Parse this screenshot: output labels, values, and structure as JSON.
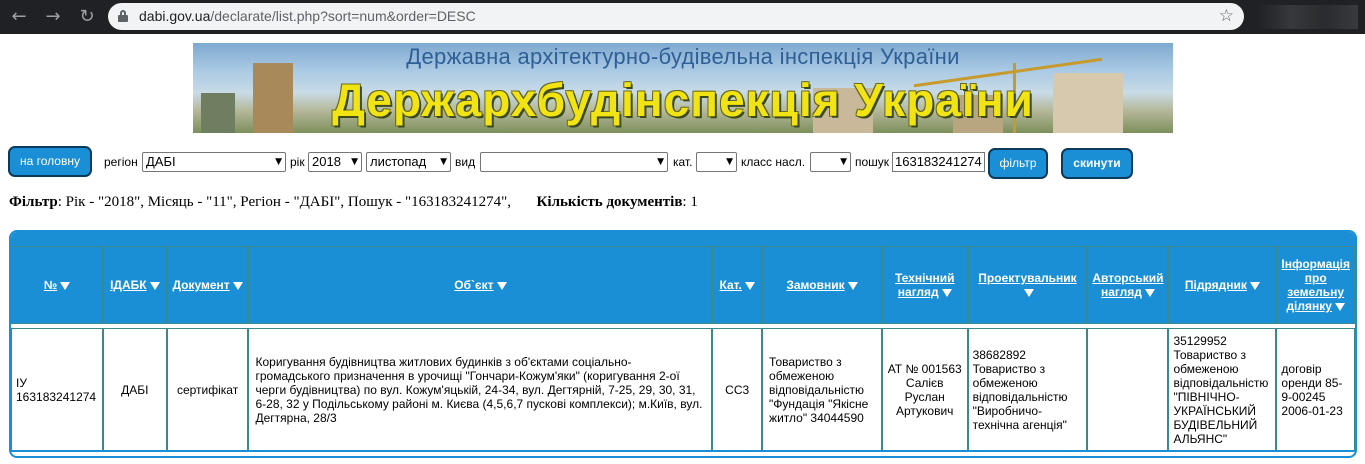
{
  "browser": {
    "url_host": "dabi.gov.ua",
    "url_path": "/declarate/list.php?sort=num&order=DESC"
  },
  "banner": {
    "subtitle": "Державна архітектурно-будівельна інспекція України",
    "title": "Держархбудінспекція України"
  },
  "filters": {
    "home_button": "на головну",
    "region_label": "регіон",
    "region_value": "ДАБІ",
    "year_label": "рік",
    "year_value": "2018",
    "month_value": "листопад",
    "kind_label": "вид",
    "kind_value": "",
    "cat_label": "кат.",
    "cat_value": "",
    "class_label": "класс насл.",
    "class_value": "",
    "search_label": "пошук",
    "search_value": "163183241274",
    "filter_button": "фільтр",
    "reset_button": "скинути"
  },
  "summary": {
    "filter_label": "Фільтр",
    "filter_text": ": Рік - \"2018\", Місяць - \"11\", Регіон - \"ДАБІ\", Пошук - \"163183241274\",",
    "count_label": "Кількість документів",
    "count_text": ": 1"
  },
  "table": {
    "headers": [
      "№",
      "ІДАБК",
      "Документ",
      "Об`єкт",
      "Кат.",
      "Замовник",
      "Технічний нагляд",
      "Проектувальник",
      "Авторський нагляд",
      "Підрядник",
      "Інформація про земельну ділянку"
    ],
    "rows": [
      {
        "num": "ІУ 163183241274",
        "idabk": "ДАБІ",
        "document": "сертифікат",
        "object": "Коригування будівництва житлових будинків з об'єктами соціально-громадського призначення в урочищі \"Гончари-Кожум'яки\" (коригування 2-ої черги будівництва) по вул. Кожум'яцькій, 24-34, вул. Дегтярній, 7-25, 29, 30, 31, 6-28, 32 у Подільському районі м. Києва (4,5,6,7 пускові комплекси); м.Київ, вул. Дегтярна, 28/3",
        "cat": "СС3",
        "customer": "Товариство з обмеженою відповідальністю \"Фундація \"Якісне житло\" 34044590",
        "tech_supervision": "АТ № 001563 Салієв Руслан Артукович",
        "designer": "38682892 Товариство з обмеженою відповідальністю \"Виробничо-технічна агенція\"",
        "author_supervision": "",
        "contractor": "35129952 Товариство з обмеженою відповідальністю \"ПІВНІЧНО-УКРАЇНСЬКИЙ БУДІВЕЛЬНИЙ АЛЬЯНС\"",
        "land_info": "договір оренди 85-9-00245 2006-01-23"
      }
    ]
  }
}
